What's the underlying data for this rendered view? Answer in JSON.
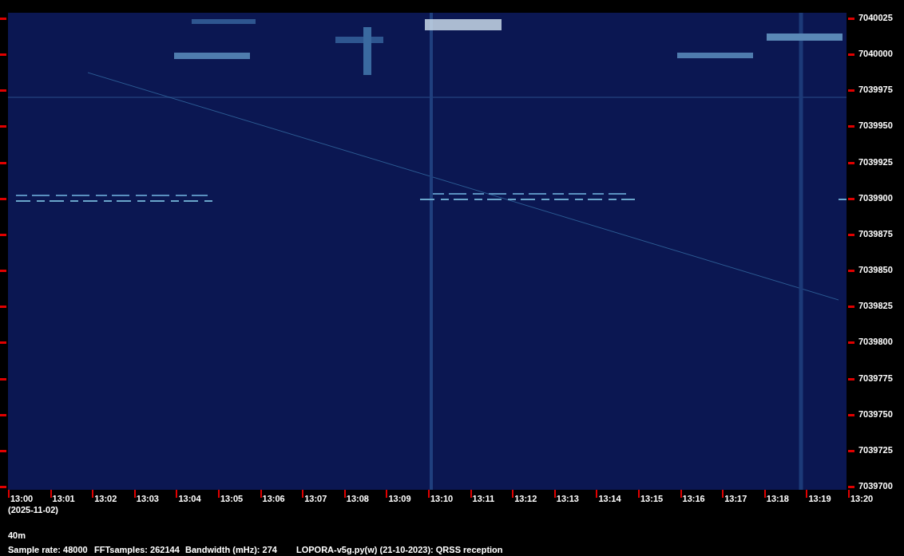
{
  "plot": {
    "frequency_labels": [
      "7040025",
      "7040000",
      "7039975",
      "7039950",
      "7039925",
      "7039900",
      "7039875",
      "7039850",
      "7039825",
      "7039800",
      "7039775",
      "7039750",
      "7039725",
      "7039700"
    ],
    "time_labels": [
      "13:00",
      "13:01",
      "13:02",
      "13:03",
      "13:04",
      "13:05",
      "13:06",
      "13:07",
      "13:08",
      "13:09",
      "13:10",
      "13:11",
      "13:12",
      "13:13",
      "13:14",
      "13:15",
      "13:16",
      "13:17",
      "13:18",
      "13:19",
      "13:20"
    ],
    "date": "(2025-11-02)"
  },
  "band": "40m",
  "info": [
    "Sample rate: 48000",
    "FFTsamples: 262144",
    "Bandwidth (mHz): 274",
    "LOPORA-v5g.py(w) (21-10-2023): QRSS reception"
  ]
}
